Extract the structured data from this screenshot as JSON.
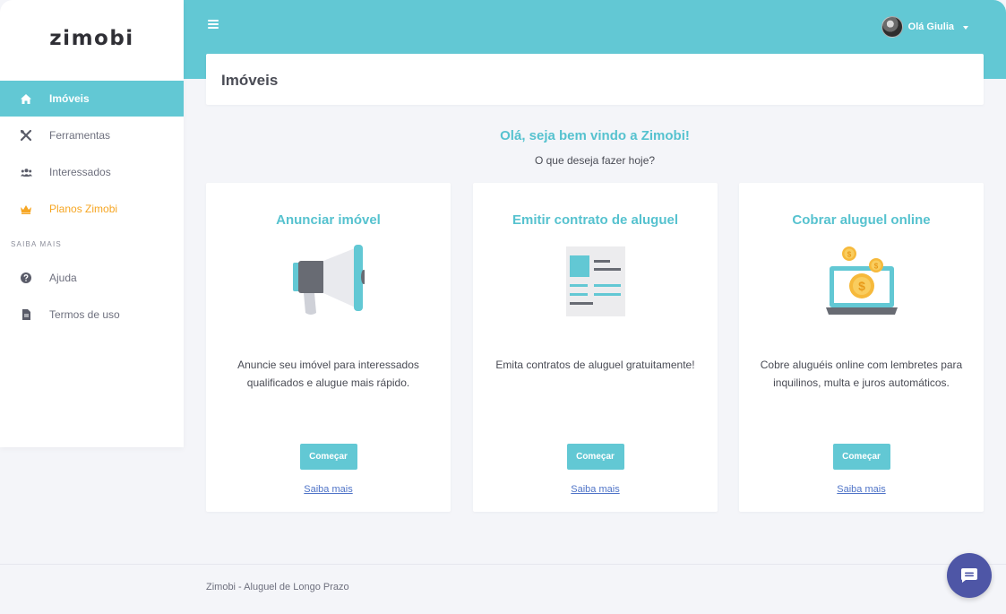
{
  "app": {
    "logo": "zimobi"
  },
  "header": {
    "user_greeting": "Olá Giulia"
  },
  "sidebar": {
    "items": [
      {
        "label": "Imóveis",
        "icon": "home-icon",
        "active": true
      },
      {
        "label": "Ferramentas",
        "icon": "tools-icon"
      },
      {
        "label": "Interessados",
        "icon": "users-icon"
      },
      {
        "label": "Planos Zimobi",
        "icon": "crown-icon",
        "highlight": "#f6a623"
      }
    ],
    "section_label": "SAIBA MAIS",
    "secondary_items": [
      {
        "label": "Ajuda",
        "icon": "question-circle-icon"
      },
      {
        "label": "Termos de uso",
        "icon": "file-icon"
      }
    ]
  },
  "page": {
    "title": "Imóveis",
    "welcome_title": "Olá, seja bem vindo a Zimobi!",
    "welcome_subtitle": "O que deseja fazer hoje?"
  },
  "cards": [
    {
      "title": "Anunciar imóvel",
      "icon": "megaphone-icon",
      "description": "Anuncie seu imóvel para interessados qualificados e alugue mais rápido.",
      "button": "Começar",
      "link": "Saiba mais"
    },
    {
      "title": "Emitir contrato de aluguel",
      "icon": "contract-document-icon",
      "description": "Emita contratos de aluguel gratuitamente!",
      "button": "Começar",
      "link": "Saiba mais"
    },
    {
      "title": "Cobrar aluguel online",
      "icon": "laptop-coins-icon",
      "description": "Cobre aluguéis online com lembretes para inquilinos, multa e juros automáticos.",
      "button": "Começar",
      "link": "Saiba mais"
    }
  ],
  "footer": {
    "text": "Zimobi - Aluguel de Longo Prazo"
  },
  "colors": {
    "accent": "#62c8d4",
    "title_accent": "#56c2cf",
    "orange": "#f6a623",
    "chat": "#4e56a6",
    "link": "#4e73c7"
  }
}
